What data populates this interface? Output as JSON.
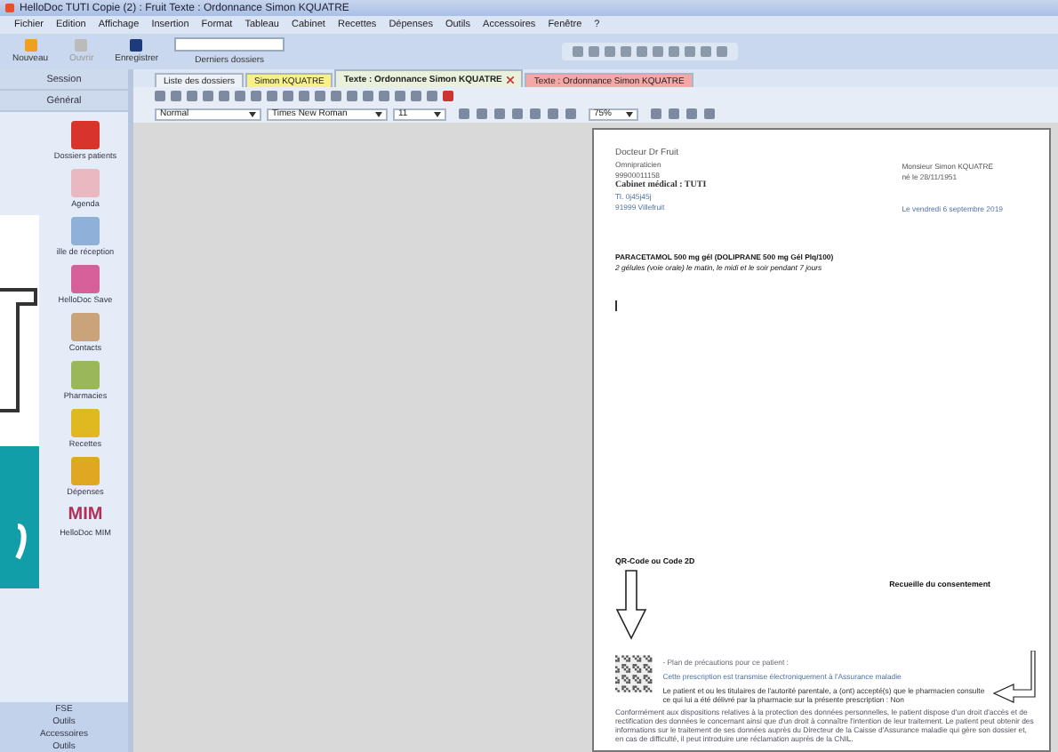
{
  "window": {
    "title": "HelloDoc  TUTI  Copie (2) : Fruit  Texte : Ordonnance Simon KQUATRE"
  },
  "menu": [
    "Fichier",
    "Edition",
    "Affichage",
    "Insertion",
    "Format",
    "Tableau",
    "Cabinet",
    "Recettes",
    "Dépenses",
    "Outils",
    "Accessoires",
    "Fenêtre",
    "?"
  ],
  "toolbar": {
    "buttons": [
      {
        "label": "Nouveau",
        "disabled": false
      },
      {
        "label": "Ouvrir",
        "disabled": true
      },
      {
        "label": "Enregistrer",
        "disabled": false
      }
    ],
    "recent": {
      "label": "Derniers dossiers"
    }
  },
  "tabs": [
    {
      "label": "Liste des dossiers",
      "selected": false,
      "color": "#eef2f8",
      "closable": false
    },
    {
      "label": "Simon KQUATRE",
      "selected": false,
      "color": "#f7f08a",
      "closable": false
    },
    {
      "label": "Texte : Ordonnance Simon KQUATRE",
      "selected": true,
      "color": "#e9f1dc",
      "closable": true
    },
    {
      "label": "Texte : Ordonnance Simon KQUATRE",
      "selected": false,
      "color": "#f4a7a7",
      "closable": false
    }
  ],
  "format_bar": {
    "style": "Normal",
    "font": "Times New Roman",
    "size": "11",
    "zoom": "75%"
  },
  "sidebar": {
    "headers": [
      "Session",
      "Général"
    ],
    "items": [
      {
        "label": "Dossiers patients"
      },
      {
        "label": "Agenda"
      },
      {
        "label": "ille de réception"
      },
      {
        "label": "HelloDoc Save"
      },
      {
        "label": "Contacts"
      },
      {
        "label": "Pharmacies"
      },
      {
        "label": "Recettes"
      },
      {
        "label": "Dépenses"
      },
      {
        "label": "HelloDoc MIM",
        "logo": "MIM"
      }
    ],
    "footer": [
      "FSE",
      "Outils",
      "Accessoires",
      "Outils"
    ]
  },
  "document": {
    "doctor": [
      "Docteur Dr Fruit",
      "Omnipraticien",
      "99900011158"
    ],
    "cabinet": "Cabinet médical : TUTI",
    "address": [
      "Tl. 0j45j45j",
      "91999 Villefruit"
    ],
    "patient": [
      "Monsieur Simon KQUATRE",
      "né le 28/11/1951"
    ],
    "date": "Le vendredi 6 septembre 2019",
    "drug": "PARACETAMOL 500 mg gél (DOLIPRANE 500 mg Gél Plq/100)",
    "dosage": "2 gélules (voie orale) le matin, le midi et le soir pendant 7 jours",
    "qr_label": "QR-Code ou Code 2D",
    "consent_label": "Recueille du consentement",
    "precautions": [
      "- Plan de précautions pour ce patient :",
      "Cette prescription est transmise électroniquement à l'Assurance maladie"
    ],
    "consent": "Le patient et ou les titulaires de l'autorité parentale, a (ont) accepté(s) que le pharmacien consulte ce qui lui a été délivré par la pharmacie sur la présente prescription : Non",
    "privacy": "Conformément aux dispositions relatives à la protection des données personnelles, le patient dispose d'un droit d'accès et de rectification des données le concernant ainsi que d'un droit à connaître l'intention de leur traitement. Le patient peut obtenir des informations sur le traitement de ses données auprès du Directeur de la Caisse d'Assurance maladie qui gère son dossier et, en cas de difficulté, il peut introduire une réclamation auprès de la CNIL."
  }
}
